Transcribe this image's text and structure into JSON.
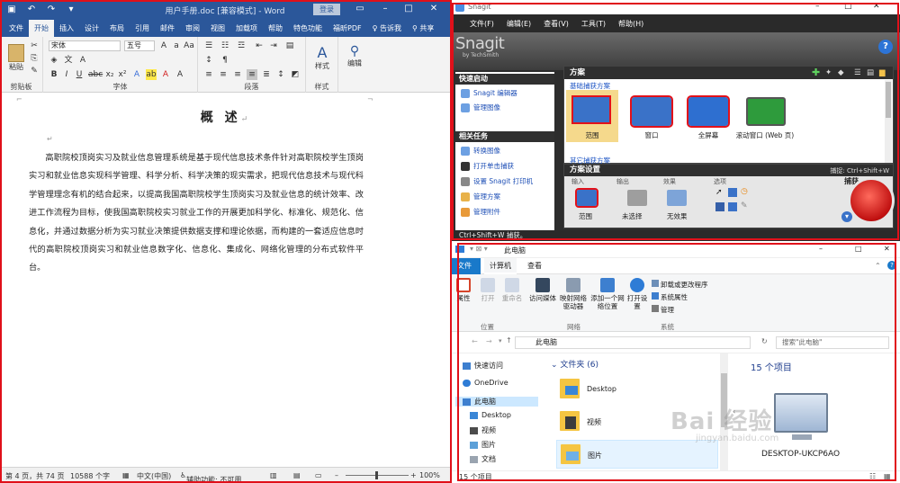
{
  "word": {
    "title": "用户手册.doc [兼容模式] - Word",
    "login_label": "登录",
    "share_label": "共享",
    "tabs": [
      "文件",
      "开始",
      "插入",
      "设计",
      "布局",
      "引用",
      "邮件",
      "审阅",
      "视图",
      "加载项",
      "帮助",
      "特色功能",
      "福昕PDF",
      "告诉我"
    ],
    "clipboard": {
      "paste_label": "粘贴",
      "group_label": "剪贴板"
    },
    "font": {
      "name": "宋体",
      "size": "五号",
      "group_label": "字体"
    },
    "paragraph": {
      "group_label": "段落"
    },
    "styles": {
      "button_label": "样式",
      "group_label": "样式"
    },
    "editing": {
      "button_label": "编辑"
    },
    "document": {
      "heading": "概   述",
      "paragraph": "高职院校顶岗实习及就业信息管理系统是基于现代信息技术条件针对高职院校学生顶岗实习和就业信息实现科学管理、科学分析、科学决策的现实需求，把现代信息技术与现代科学管理理念有机的结合起来，以提高我国高职院校学生顶岗实习及就业信息的统计效率、改进工作流程为目标，使我国高职院校实习就业工作的开展更加科学化、标准化、规范化、信息化，并通过数据分析为实习就业决策提供数据支撑和理论依据，而构建的一套适应信息时代的高职院校顶岗实习和就业信息数字化、信息化、集成化、网络化管理的分布式软件平台。"
    },
    "status": {
      "page": "第 4 页，共 74 页",
      "words": "10588 个字",
      "language": "中文(中国)",
      "accessibility": "辅助功能: 不可用",
      "zoom": "100%"
    }
  },
  "snagit": {
    "title": "Snagit",
    "menu": [
      "文件(F)",
      "编辑(E)",
      "查看(V)",
      "工具(T)",
      "帮助(H)"
    ],
    "logo": "Snagit",
    "logo_sub": "by TechSmith",
    "quick_launch": {
      "header": "快速启动",
      "items": [
        "Snagit 编辑器",
        "管理图像"
      ]
    },
    "related_tasks": {
      "header": "相关任务",
      "items": [
        "转换图像",
        "打开单击捕获",
        "设置 Snagit 打印机",
        "管理方案",
        "管理附件"
      ]
    },
    "profiles": {
      "header": "方案",
      "basic_label": "基础捕获方案",
      "other_label": "其它捕获方案",
      "tiles": [
        "范围",
        "窗口",
        "全屏幕",
        "滚动窗口 (Web 页)"
      ]
    },
    "settings": {
      "header": "方案设置",
      "hotkey": "捕捉: Ctrl+Shift+W",
      "columns": [
        "输入",
        "输出",
        "效果",
        "选项"
      ],
      "values": [
        "范围",
        "未选择",
        "无效果"
      ],
      "capture_label": "捕获"
    },
    "status": "Ctrl+Shift+W 捕获。",
    "colors": {
      "highlight": "#e2111a",
      "header": "#2f2f2f",
      "link": "#1e4fb6"
    }
  },
  "explorer": {
    "title": "此电脑",
    "tabs": [
      "文件",
      "计算机",
      "查看"
    ],
    "ribbon": {
      "location": {
        "label": "位置",
        "items": [
          "属性",
          "打开",
          "重命名"
        ]
      },
      "network": {
        "label": "网络",
        "items": [
          "访问媒体",
          "映射网络驱动器",
          "添加一个网络位置"
        ]
      },
      "system": {
        "label": "系统",
        "open_settings": "打开设置",
        "items": [
          "卸载或更改程序",
          "系统属性",
          "管理"
        ]
      }
    },
    "address": "此电脑",
    "search_placeholder": "搜索\"此电脑\"",
    "nav": [
      "快速访问",
      "OneDrive",
      "此电脑",
      "Desktop",
      "视频",
      "图片",
      "文档"
    ],
    "folders_header": "文件夹 (6)",
    "folders": [
      "Desktop",
      "视频",
      "图片"
    ],
    "preview_count": "15 个项目",
    "device_name": "DESKTOP-UKCP6AO",
    "status": "15 个项目"
  },
  "watermark": {
    "text": "Bai 经验",
    "sub": "jingyan.baidu.com"
  }
}
